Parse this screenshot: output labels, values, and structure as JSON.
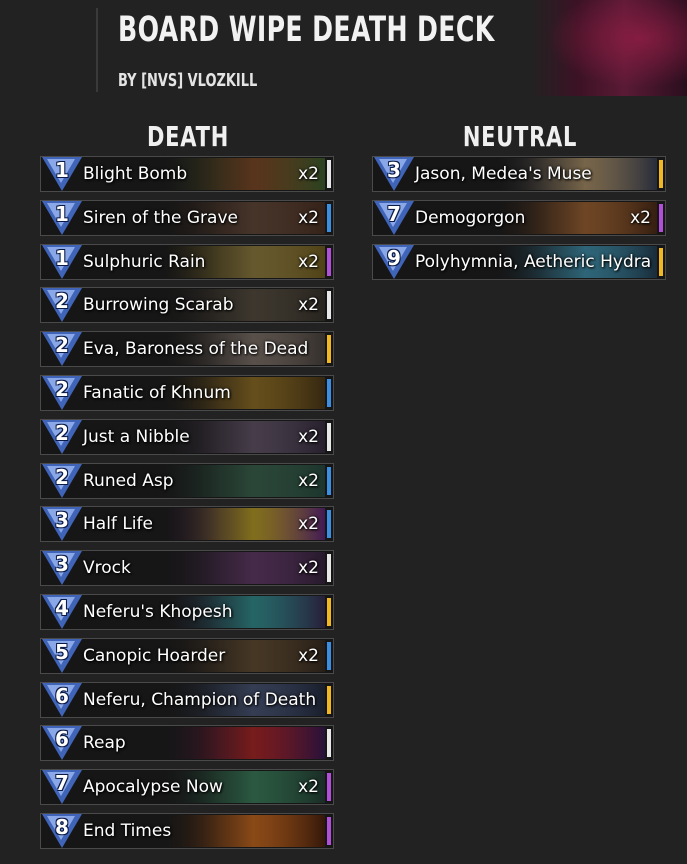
{
  "deck": {
    "title": "BOARD WIPE DEATH DECK",
    "author": "BY [NVS] VLOZKILL"
  },
  "colors": {
    "background": "#222222",
    "cost_blue": "#3f64b8",
    "rarity_common": "#e8e8e8",
    "rarity_rare": "#3b8fe0",
    "rarity_epic": "#b04fd8",
    "rarity_legendary": "#f2b822"
  },
  "columns": [
    {
      "heading": "DEATH",
      "cards": [
        {
          "cost": "1",
          "name": "Blight Bomb",
          "qty": "x2",
          "rarity": "common",
          "art": [
            "#2e4a22",
            "#8a4a20"
          ]
        },
        {
          "cost": "1",
          "name": "Siren of the Grave",
          "qty": "x2",
          "rarity": "rare",
          "art": [
            "#3a2418",
            "#6a4a38"
          ]
        },
        {
          "cost": "1",
          "name": "Sulphuric Rain",
          "qty": "x2",
          "rarity": "epic",
          "art": [
            "#5a4a18",
            "#a08a40"
          ]
        },
        {
          "cost": "2",
          "name": "Burrowing Scarab",
          "qty": "x2",
          "rarity": "common",
          "art": [
            "#2a2620",
            "#5a5040"
          ]
        },
        {
          "cost": "2",
          "name": "Eva, Baroness of the Dead",
          "qty": "",
          "rarity": "legendary",
          "art": [
            "#3a3430",
            "#8a7a70"
          ]
        },
        {
          "cost": "2",
          "name": "Fanatic of Khnum",
          "qty": "",
          "rarity": "rare",
          "art": [
            "#3a2a10",
            "#a07820"
          ]
        },
        {
          "cost": "2",
          "name": "Just a Nibble",
          "qty": "x2",
          "rarity": "common",
          "art": [
            "#2a2230",
            "#6a5a70"
          ]
        },
        {
          "cost": "2",
          "name": "Runed Asp",
          "qty": "x2",
          "rarity": "rare",
          "art": [
            "#1e3a30",
            "#3a6a50"
          ]
        },
        {
          "cost": "3",
          "name": "Half Life",
          "qty": "x2",
          "rarity": "rare",
          "art": [
            "#4a1a60",
            "#d0b020"
          ]
        },
        {
          "cost": "3",
          "name": "Vrock",
          "qty": "x2",
          "rarity": "common",
          "art": [
            "#2a1a30",
            "#6a3a70"
          ]
        },
        {
          "cost": "4",
          "name": "Neferu's Khopesh",
          "qty": "",
          "rarity": "legendary",
          "art": [
            "#2a2040",
            "#30a0a0"
          ]
        },
        {
          "cost": "5",
          "name": "Canopic Hoarder",
          "qty": "x2",
          "rarity": "rare",
          "art": [
            "#2a2018",
            "#6a5030"
          ]
        },
        {
          "cost": "6",
          "name": "Neferu, Champion of Death",
          "qty": "",
          "rarity": "legendary",
          "art": [
            "#1a2030",
            "#4a5a80"
          ]
        },
        {
          "cost": "6",
          "name": "Reap",
          "qty": "",
          "rarity": "common",
          "art": [
            "#2a1040",
            "#c02020"
          ]
        },
        {
          "cost": "7",
          "name": "Apocalypse Now",
          "qty": "x2",
          "rarity": "epic",
          "art": [
            "#1a3028",
            "#3a8a60"
          ]
        },
        {
          "cost": "8",
          "name": "End Times",
          "qty": "",
          "rarity": "epic",
          "art": [
            "#3a1808",
            "#e07018"
          ]
        }
      ]
    },
    {
      "heading": "NEUTRAL",
      "cards": [
        {
          "cost": "3",
          "name": "Jason, Medea's Muse",
          "qty": "",
          "rarity": "legendary",
          "art": [
            "#2a3040",
            "#c0a070"
          ]
        },
        {
          "cost": "7",
          "name": "Demogorgon",
          "qty": "x2",
          "rarity": "epic",
          "art": [
            "#3a2010",
            "#b06a30"
          ]
        },
        {
          "cost": "9",
          "name": "Polyhymnia, Aetheric Hydra",
          "qty": "",
          "rarity": "legendary",
          "art": [
            "#1a3040",
            "#40a0c0"
          ]
        }
      ]
    }
  ]
}
